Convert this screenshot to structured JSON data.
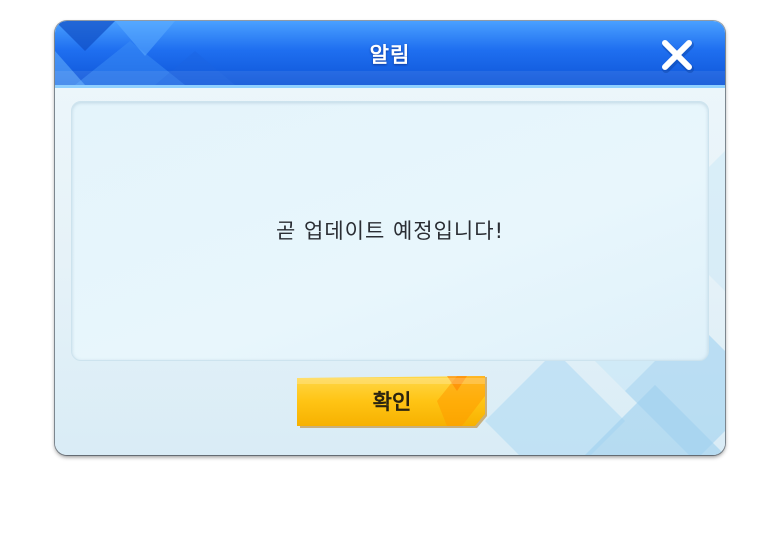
{
  "dialog": {
    "title": "알림",
    "message": "곧 업데이트 예정입니다!",
    "confirm_label": "확인",
    "close_icon": "close-icon"
  },
  "colors": {
    "header_top": "#4aa0ff",
    "header_bottom": "#0e55d8",
    "button_yellow": "#ffc61a",
    "button_orange": "#ff9a00",
    "panel_bg": "#e6f4fb"
  }
}
